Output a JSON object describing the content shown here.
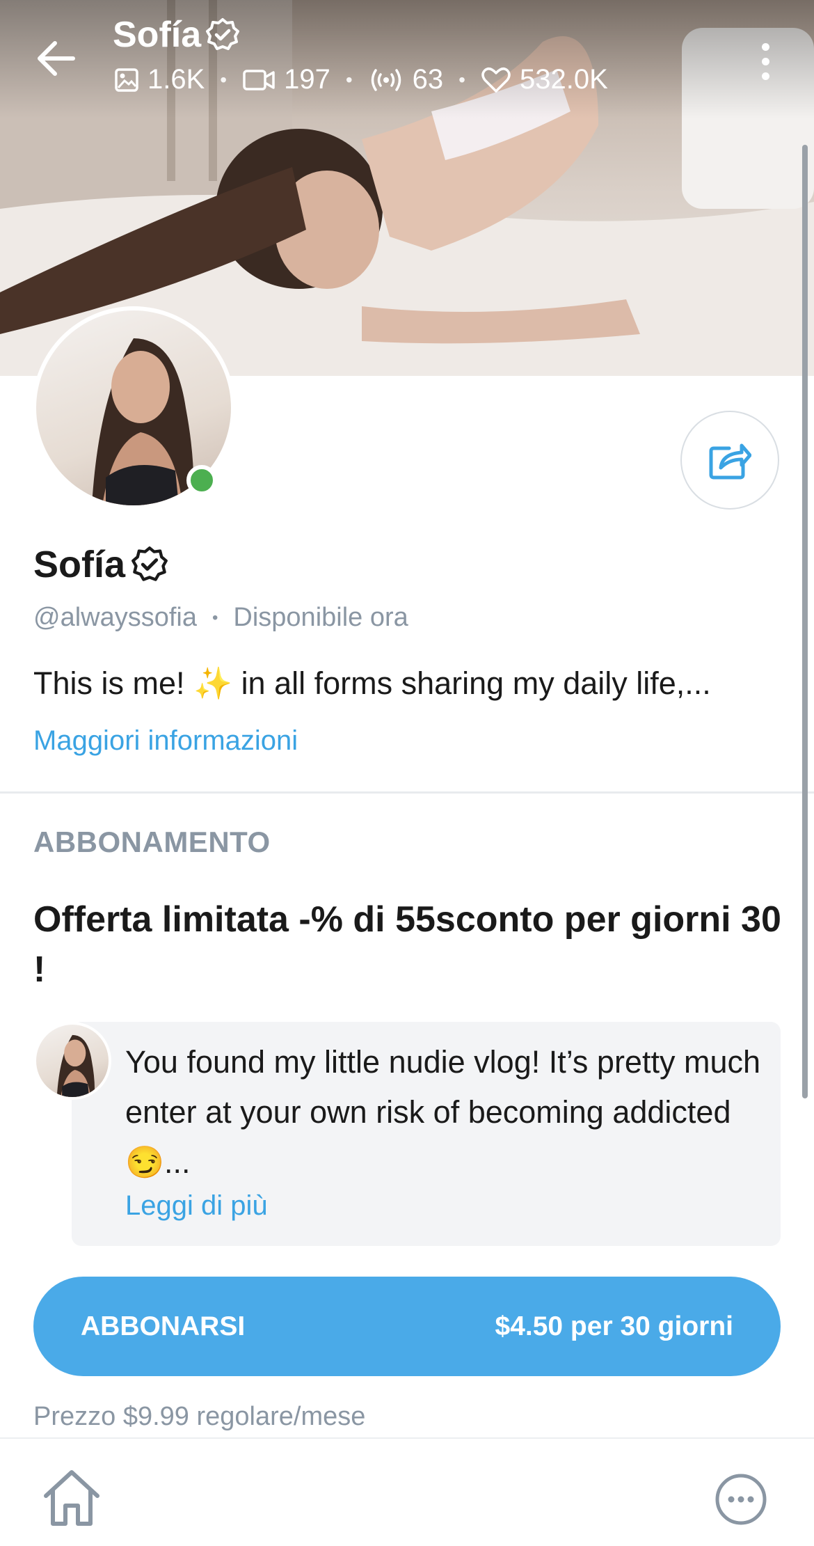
{
  "header": {
    "name": "Sofía",
    "stats": {
      "photos": "1.6K",
      "videos": "197",
      "streams": "63",
      "likes": "532.0K"
    },
    "stat_separator": "•"
  },
  "profile": {
    "name": "Sofía",
    "handle": "@alwayssofia",
    "separator": "•",
    "status": "Disponibile ora",
    "bio": "This is me! ✨ in all forms sharing my daily life,...",
    "more_info_label": "Maggiori informazioni",
    "online": true
  },
  "subscription": {
    "section_label": "ABBONAMENTO",
    "offer_text": "Offerta limitata -% di 55sconto per giorni 30 !",
    "promo_message": "You found my little nudie vlog! It’s pretty much enter at your own risk of becoming addicted 😏...",
    "read_more_label": "Leggi di più",
    "button_label": "ABBONARSI",
    "button_price": "$4.50 per 30 giorni",
    "regular_price": "Prezzo $9.99 regolare/mese"
  },
  "icons": {
    "back": "arrow-left-icon",
    "verified": "verified-badge-icon",
    "photos": "image-icon",
    "videos": "video-icon",
    "streams": "broadcast-icon",
    "likes": "heart-icon",
    "more": "more-vertical-icon",
    "share": "share-icon",
    "home": "home-icon",
    "chat": "chat-bubble-icon"
  },
  "colors": {
    "accent": "#4aaae8",
    "link": "#3aa3e3",
    "muted": "#8a96a3",
    "online": "#4caf50"
  }
}
